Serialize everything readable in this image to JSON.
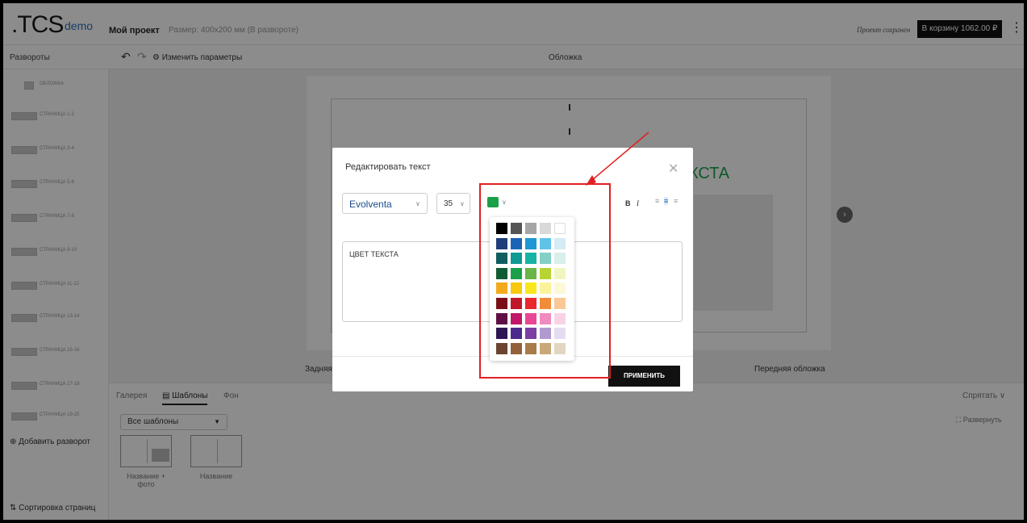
{
  "header": {
    "logo": ".TCS",
    "logo_suffix": "demo",
    "project_name": "Мой проект",
    "project_size": "Размер: 400x200 мм (В развороте)",
    "saved_status": "Проект сохранен",
    "cart_button": "В корзину 1062.00 ₽",
    "menu_icon": "⋮"
  },
  "toolbar": {
    "spreads_title": "Развороты",
    "undo_icon": "↶",
    "redo_icon": "↷",
    "params_label": "⚙ Изменить параметры",
    "current_view": "Обложка"
  },
  "sidebar": {
    "items": [
      {
        "label": "Обложка"
      },
      {
        "label": "Страница 1-2"
      },
      {
        "label": "Страница 3-4"
      },
      {
        "label": "Страница 5-6"
      },
      {
        "label": "Страница 7-8"
      },
      {
        "label": "Страница 9-10"
      },
      {
        "label": "Страница 11-12"
      },
      {
        "label": "Страница 13-14"
      },
      {
        "label": "Страница 15-16"
      },
      {
        "label": "Страница 17-18"
      },
      {
        "label": "Страница 19-20"
      }
    ],
    "add_spread": "⊕  Добавить разворот",
    "sort_pages": "⇅ Сортировка страниц"
  },
  "canvas": {
    "text_preview": "КСТА",
    "back_cover_label": "Задняя",
    "front_cover_label": "Передняя обложка",
    "next_icon": "›"
  },
  "bottom_panel": {
    "tabs": [
      {
        "label": "Галерея"
      },
      {
        "label": "Шаблоны",
        "icon": "▤"
      },
      {
        "label": "Фон"
      }
    ],
    "hide_label": "Спрятать ∨",
    "expand_label": "⛶ Развернуть",
    "template_filter": "Все шаблоны",
    "templates": [
      {
        "name": "Название + фото"
      },
      {
        "name": "Название"
      }
    ]
  },
  "modal": {
    "title": "Редактировать текст",
    "close_icon": "✕",
    "font_family": "Evolventa",
    "font_size": "35",
    "current_color": "#1aa049",
    "bold_label": "B",
    "italic_label": "I",
    "align_icons": [
      "≡",
      "≡",
      "≡"
    ],
    "text_value": "ЦВЕТ ТЕКСТА",
    "apply_button": "ПРИМЕНИТЬ"
  },
  "palette": {
    "rows": [
      [
        "#000000",
        "#555555",
        "#a6a6a6",
        "#d9d9d9",
        "#ffffff"
      ],
      [
        "#1f3d7a",
        "#1b64b5",
        "#1f97d4",
        "#5fc3e8",
        "#d3ecf5"
      ],
      [
        "#0e5e5f",
        "#0f9a93",
        "#18b3a3",
        "#84cfc6",
        "#d8efea"
      ],
      [
        "#0d5c34",
        "#1aa049",
        "#6ab547",
        "#b8d432",
        "#f1f5c0"
      ],
      [
        "#f2a91c",
        "#f7c80b",
        "#f8e71c",
        "#fbf39b",
        "#fdf8d8"
      ],
      [
        "#7a0f1a",
        "#c0182a",
        "#e8282c",
        "#f28c3a",
        "#f9c896"
      ],
      [
        "#5e1046",
        "#c21768",
        "#e94795",
        "#f08bbf",
        "#f8d3e6"
      ],
      [
        "#2e1655",
        "#4a2b8c",
        "#7a3fa0",
        "#b19ad0",
        "#e4ddf1"
      ],
      [
        "#6b4530",
        "#92613c",
        "#a87c4a",
        "#c9a878",
        "#e2d6c0"
      ]
    ]
  }
}
